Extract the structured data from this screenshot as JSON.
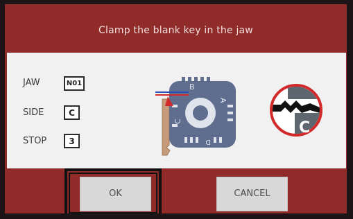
{
  "dialog": {
    "title": "Clamp the blank key in the jaw"
  },
  "settings": {
    "jaw": {
      "label": "JAW",
      "value": "N01"
    },
    "side": {
      "label": "SIDE",
      "value": "C"
    },
    "stop": {
      "label": "STOP",
      "value": "3"
    }
  },
  "diagram": {
    "jaw_sides": [
      "A",
      "B",
      "C",
      "D"
    ],
    "badge_letter": "C"
  },
  "buttons": {
    "ok_label": "OK",
    "cancel_label": "CANCEL"
  },
  "colors": {
    "background": "#8f2b29",
    "panel": "#f1f1f1",
    "jaw_body": "#5f6d8f",
    "badge_ring": "#d22a2a",
    "badge_metal": "#5e6670"
  }
}
